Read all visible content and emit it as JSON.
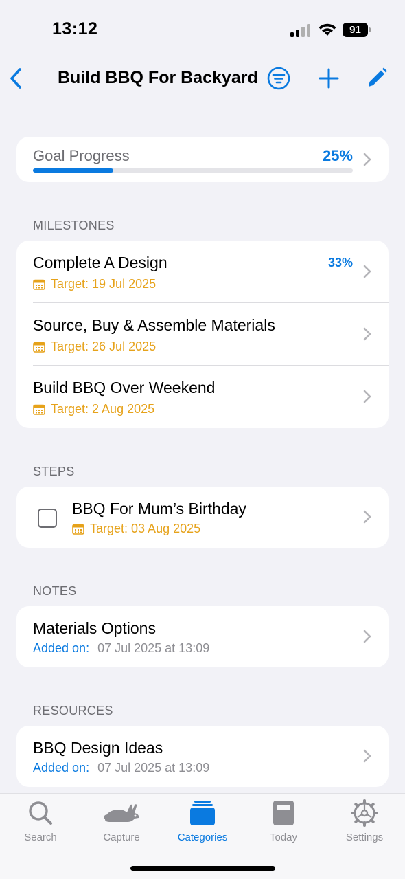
{
  "status": {
    "time": "13:12",
    "battery": "91"
  },
  "nav": {
    "title": "Build BBQ For Backyard",
    "accent": "#0a7ae0"
  },
  "goal_progress": {
    "label": "Goal Progress",
    "percent_text": "25%",
    "value": 0.25
  },
  "milestones": {
    "header": "MILESTONES",
    "items": [
      {
        "title": "Complete A Design",
        "target": "Target: 19 Jul 2025",
        "percent": "33%"
      },
      {
        "title": "Source, Buy & Assemble Materials",
        "target": "Target: 26 Jul 2025",
        "percent": ""
      },
      {
        "title": "Build BBQ Over Weekend",
        "target": "Target: 2 Aug 2025",
        "percent": ""
      }
    ]
  },
  "steps": {
    "header": "STEPS",
    "items": [
      {
        "title": "BBQ For Mum’s Birthday",
        "target": "Target: 03 Aug 2025",
        "checked": false
      }
    ]
  },
  "notes": {
    "header": "NOTES",
    "items": [
      {
        "title": "Materials Options",
        "added_label": "Added on:",
        "added_value": "07 Jul 2025 at 13:09"
      }
    ]
  },
  "resources": {
    "header": "RESOURCES",
    "items": [
      {
        "title": "BBQ Design Ideas",
        "added_label": "Added on:",
        "added_value": "07 Jul 2025 at 13:09"
      }
    ]
  },
  "tabbar": {
    "tabs": [
      {
        "label": "Search",
        "icon": "search-icon"
      },
      {
        "label": "Capture",
        "icon": "rabbit-icon"
      },
      {
        "label": "Categories",
        "icon": "folder-stack-icon",
        "active": true
      },
      {
        "label": "Today",
        "icon": "notebook-icon"
      },
      {
        "label": "Settings",
        "icon": "gear-icon"
      }
    ]
  }
}
